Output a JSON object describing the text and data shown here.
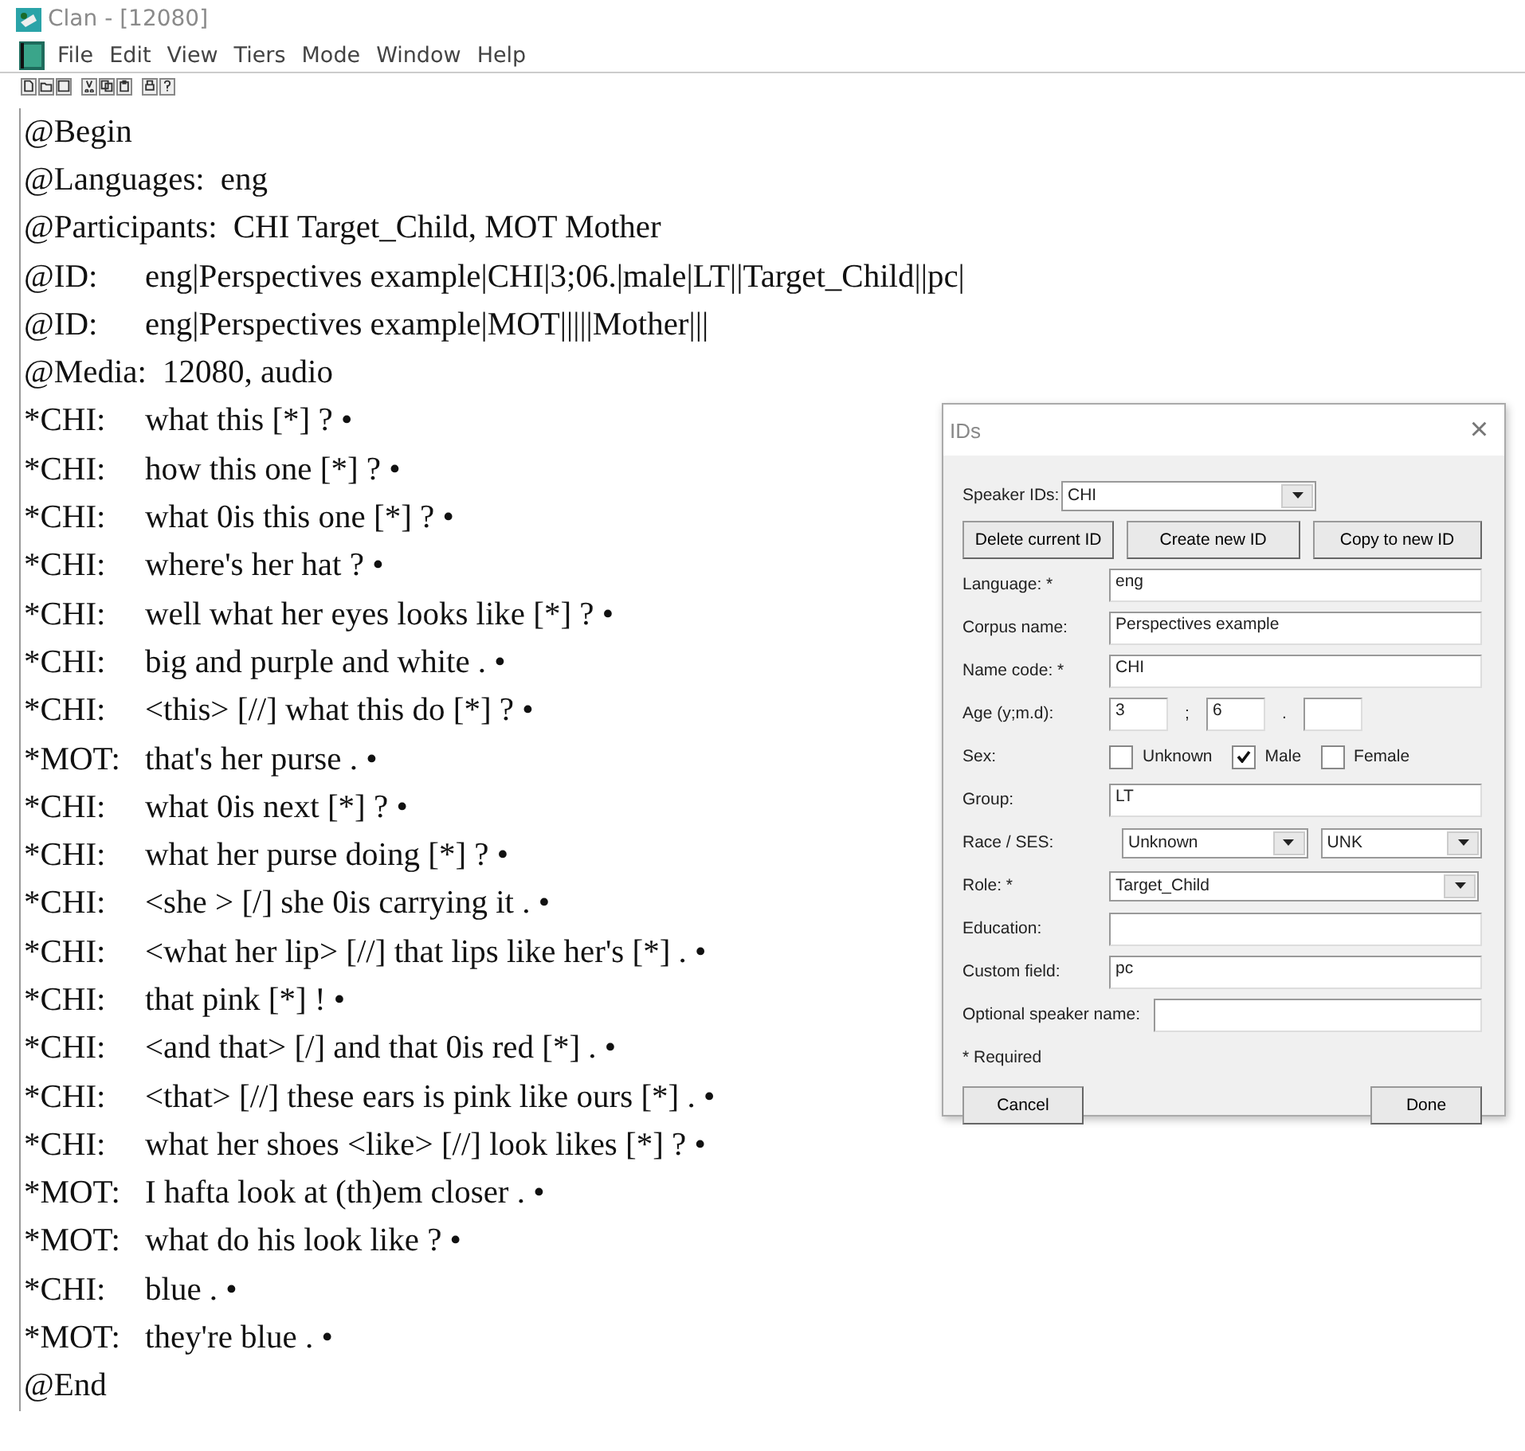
{
  "window": {
    "title": "Clan - [12080]"
  },
  "menu": [
    "File",
    "Edit",
    "View",
    "Tiers",
    "Mode",
    "Window",
    "Help"
  ],
  "toolbar": [
    {
      "kind": "new"
    },
    {
      "kind": "open"
    },
    {
      "kind": "save"
    },
    {
      "kind": "cut"
    },
    {
      "kind": "copy"
    },
    {
      "kind": "paste"
    },
    {
      "kind": "print"
    },
    {
      "kind": "help"
    }
  ],
  "transcript": [
    {
      "tier": "@Begin"
    },
    {
      "tier": "@Languages:",
      "text": "eng"
    },
    {
      "tier": "@Participants:",
      "text": "CHI Target_Child, MOT Mother"
    },
    {
      "tier": "@ID:",
      "text": "eng|Perspectives example|CHI|3;06.|male|LT||Target_Child||pc|"
    },
    {
      "tier": "@ID:",
      "text": "eng|Perspectives example|MOT|||||Mother|||"
    },
    {
      "tier": "@Media:",
      "text": "12080, audio"
    },
    {
      "tier": "*CHI:",
      "text": "what this [*] ? •"
    },
    {
      "tier": "*CHI:",
      "text": "how this one [*] ? •"
    },
    {
      "tier": "*CHI:",
      "text": "what 0is this one [*] ? •"
    },
    {
      "tier": "*CHI:",
      "text": "where's her hat ? •"
    },
    {
      "tier": "*CHI:",
      "text": "well what her eyes looks like [*] ? •"
    },
    {
      "tier": "*CHI:",
      "text": "big and purple and white . •"
    },
    {
      "tier": "*CHI:",
      "text": "<this> [//] what this do [*] ? •"
    },
    {
      "tier": "*MOT:",
      "text": "that's her purse . •"
    },
    {
      "tier": "*CHI:",
      "text": "what 0is next [*] ? •"
    },
    {
      "tier": "*CHI:",
      "text": "what her purse doing [*] ? •"
    },
    {
      "tier": "*CHI:",
      "text": "<she > [/] she 0is carrying it . •"
    },
    {
      "tier": "*CHI:",
      "text": "<what her lip> [//] that lips like her's [*] . •"
    },
    {
      "tier": "*CHI:",
      "text": "that pink [*] ! •"
    },
    {
      "tier": "*CHI:",
      "text": "<and that> [/] and that 0is red [*] . •"
    },
    {
      "tier": "*CHI:",
      "text": "<that> [//] these ears is pink like ours [*] . •"
    },
    {
      "tier": "*CHI:",
      "text": "what her shoes <like> [//] look likes [*] ? •"
    },
    {
      "tier": "*MOT:",
      "text": "I hafta look at (th)em closer . •"
    },
    {
      "tier": "*MOT:",
      "text": "what do his look like ? •"
    },
    {
      "tier": "*CHI:",
      "text": "blue . •"
    },
    {
      "tier": "*MOT:",
      "text": "they're blue . •"
    },
    {
      "tier": "@End"
    }
  ],
  "dialog": {
    "title": "IDs",
    "close": "×",
    "speaker_ids": {
      "label": "Speaker IDs:",
      "value": "CHI"
    },
    "buttons": [
      "Delete current ID",
      "Create new ID",
      "Copy to new ID"
    ],
    "language": {
      "label": "Language: *",
      "value": "eng"
    },
    "corpus_name": {
      "label": "Corpus name:",
      "value": "Perspectives example"
    },
    "name_code": {
      "label": "Name code: *",
      "value": "CHI"
    },
    "age": {
      "label": "Age (y;m.d):",
      "years": "3",
      "sep1": ";",
      "months": "6",
      "sep2": "."
    },
    "sex": {
      "label": "Sex:",
      "options": [
        {
          "label": "Unknown",
          "checked": false
        },
        {
          "label": "Male",
          "checked": true
        },
        {
          "label": "Female",
          "checked": false
        }
      ]
    },
    "group": {
      "label": "Group:",
      "value": "LT"
    },
    "race_ses": {
      "label": "Race / SES:",
      "race": "Unknown",
      "ses": "UNK"
    },
    "role": {
      "label": "Role: *",
      "value": "Target_Child"
    },
    "education": {
      "label": "Education:"
    },
    "custom_field": {
      "label": "Custom field:",
      "value": "pc"
    },
    "optional_speaker_name": {
      "label": "Optional speaker name:"
    },
    "required_note": "* Required",
    "cancel": "Cancel",
    "done": "Done"
  }
}
